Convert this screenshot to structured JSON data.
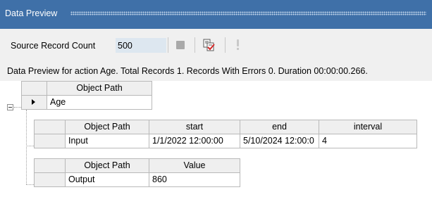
{
  "window": {
    "title": "Data Preview"
  },
  "toolbar": {
    "source_record_count_label": "Source Record Count",
    "source_record_count_value": "500",
    "icons": [
      "stop-icon",
      "validate-check-icon",
      "exclamation-icon"
    ]
  },
  "status": {
    "text": "Data Preview for action Age. Total Records 1. Records With Errors 0. Duration 00:00:00.266."
  },
  "top_grid": {
    "header": "Object Path",
    "row_value": "Age"
  },
  "input_grid": {
    "headers": [
      "Object Path",
      "start",
      "end",
      "interval"
    ],
    "row": [
      "Input",
      "1/1/2022 12:00:00",
      "5/10/2024 12:00:0",
      "4"
    ]
  },
  "output_grid": {
    "headers": [
      "Object Path",
      "Value"
    ],
    "row": [
      "Output",
      "860"
    ]
  },
  "colors": {
    "titlebar": "#3f70a8",
    "toolbar": "#f0f0f0",
    "header_cell": "#efefef",
    "count_field": "#dde7f0"
  }
}
